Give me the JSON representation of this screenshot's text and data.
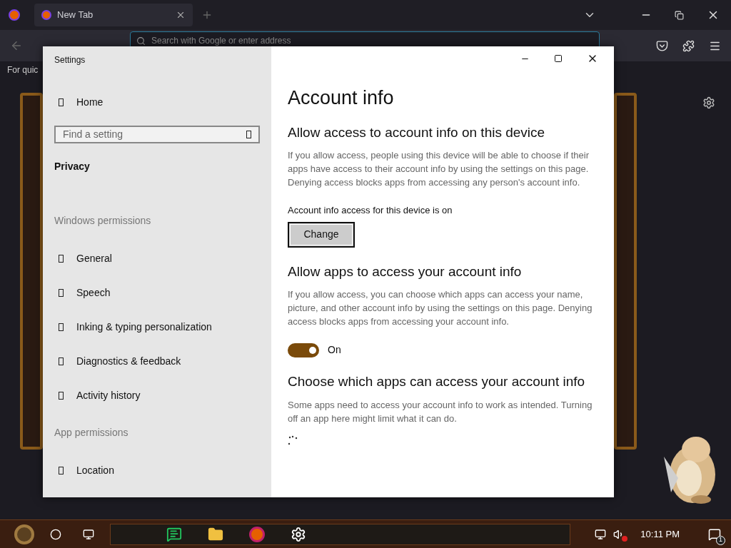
{
  "browser": {
    "tabs": [
      {
        "title": "New Tab",
        "selected": true
      }
    ],
    "address_placeholder": "Search with Google or enter address",
    "bookmarks_text": "For quic"
  },
  "settings": {
    "title": "Settings",
    "sidebar": {
      "home": "Home",
      "search_placeholder": "Find a setting",
      "current": "Privacy",
      "sections": [
        {
          "heading": "Windows permissions",
          "items": [
            {
              "label": "General"
            },
            {
              "label": "Speech"
            },
            {
              "label": "Inking & typing personalization"
            },
            {
              "label": "Diagnostics & feedback"
            },
            {
              "label": "Activity history"
            }
          ]
        },
        {
          "heading": "App permissions",
          "items": [
            {
              "label": "Location"
            }
          ]
        }
      ]
    },
    "content": {
      "title": "Account info",
      "sections": [
        {
          "kind": "change",
          "heading": "Allow access to account info on this device",
          "description": "If you allow access, people using this device will be able to choose if their apps have access to their account info by using the settings on this page. Denying access blocks apps from accessing any person's account info.",
          "status": "Account info access for this device is on",
          "button": "Change"
        },
        {
          "kind": "toggle",
          "heading": "Allow apps to access your account info",
          "description": "If you allow access, you can choose which apps can access your name, picture, and other account info by using the settings on this page. Denying access blocks apps from accessing your account info.",
          "on": true,
          "toggle_label": "On"
        },
        {
          "kind": "loading",
          "heading": "Choose which apps can access your account info",
          "description": "Some apps need to access your account info to work as intended. Turning off an app here might limit what it can do."
        }
      ]
    }
  },
  "taskbar": {
    "time": "10:11 PM",
    "muted": true,
    "notification_count": "1"
  }
}
